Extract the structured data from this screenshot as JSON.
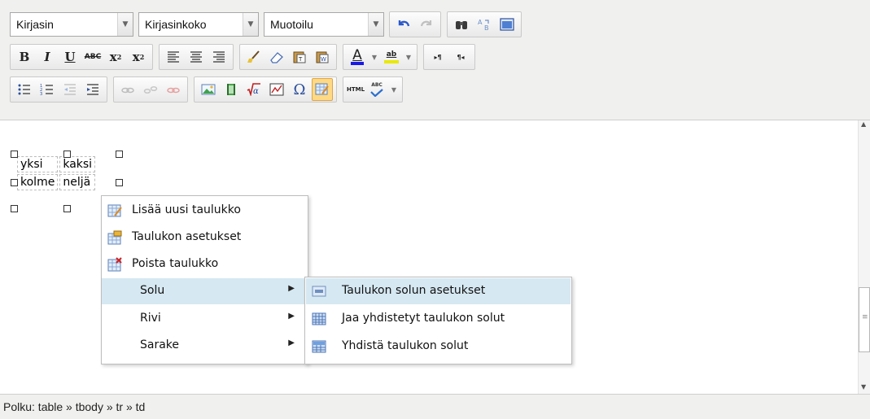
{
  "toolbar": {
    "font_select": "Kirjasin",
    "size_select": "Kirjasinkoko",
    "format_select": "Muotoilu",
    "bold": "B",
    "italic": "I",
    "underline": "U",
    "strike": "ABC",
    "subscript": "x",
    "superscript": "x",
    "font_color": "A",
    "highlight": "ab",
    "ltr": "▸¶",
    "rtl": "¶◂",
    "html": "HTML",
    "spell": "ABC",
    "omega": "Ω"
  },
  "table": {
    "cells": [
      [
        "yksi",
        "kaksi"
      ],
      [
        "kolme",
        "neljä"
      ]
    ]
  },
  "context_menu": {
    "items": [
      {
        "label": "Lisää uusi taulukko",
        "icon": "insert-table-icon"
      },
      {
        "label": "Taulukon asetukset",
        "icon": "table-props-icon"
      },
      {
        "label": "Poista taulukko",
        "icon": "delete-table-icon"
      },
      {
        "label": "Solu"
      },
      {
        "label": "Rivi"
      },
      {
        "label": "Sarake"
      }
    ]
  },
  "submenu": {
    "items": [
      {
        "label": "Taulukon solun asetukset",
        "icon": "cell-props-icon"
      },
      {
        "label": "Jaa yhdistetyt taulukon solut",
        "icon": "split-cells-icon"
      },
      {
        "label": "Yhdistä taulukon solut",
        "icon": "merge-cells-icon"
      }
    ]
  },
  "status": {
    "path": "Polku: table » tbody » tr » td"
  },
  "colors": {
    "toolbar_bg": "#f0f0ee",
    "menu_highlight": "#d6e8f2",
    "font_color_bar": "#1a1ae6",
    "highlight_bar": "#e8e800"
  }
}
